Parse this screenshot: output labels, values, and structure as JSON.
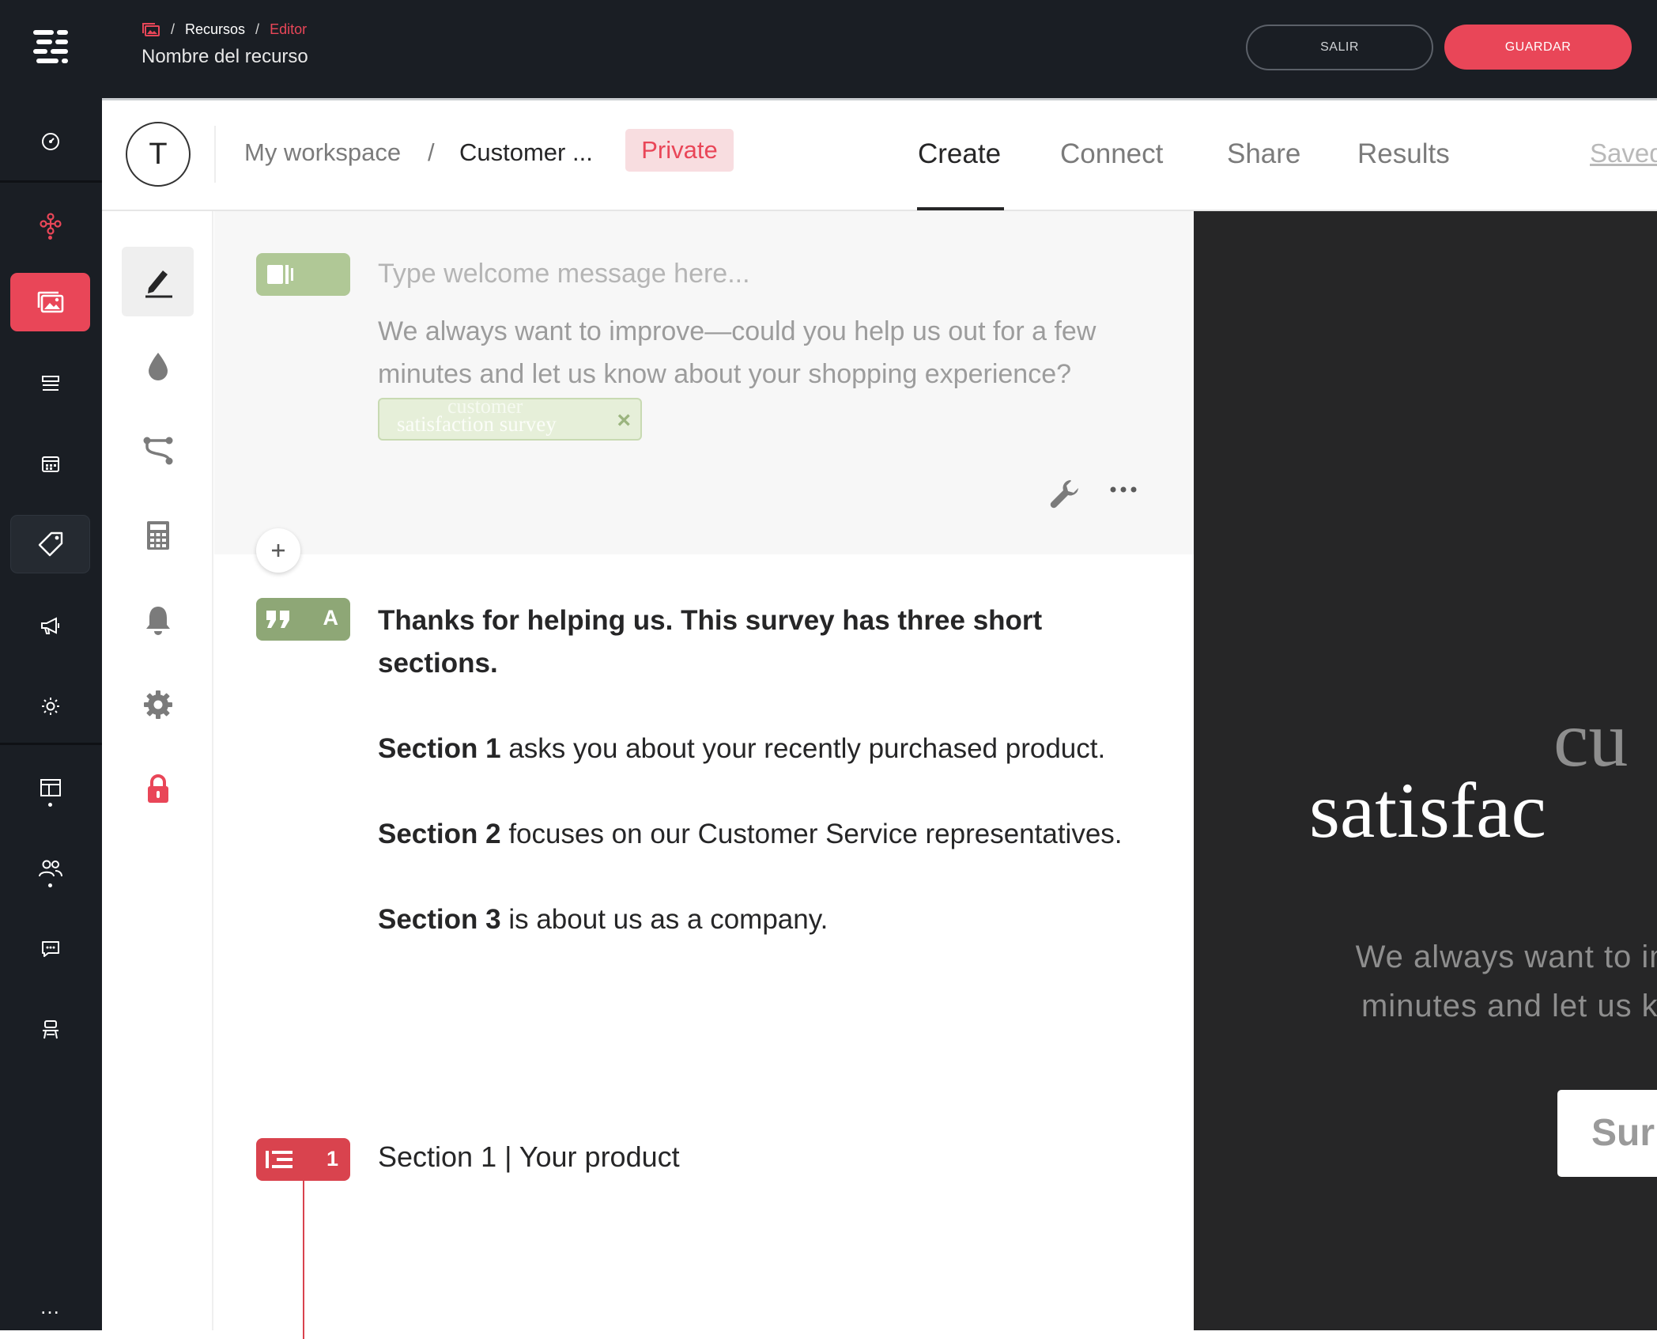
{
  "topbar": {
    "breadcrumb": [
      "Recursos",
      "Editor"
    ],
    "breadcrumb_sep": "/",
    "resource_name": "Nombre del recurso",
    "exit_label": "SALIR",
    "save_label": "GUARDAR"
  },
  "rail": {
    "items": [
      "menu-icon",
      "dashboard-icon",
      "integrations-icon",
      "media-icon",
      "list-icon",
      "calendar-icon",
      "tag-icon",
      "megaphone-icon",
      "brightness-icon",
      "layout-icon",
      "users-icon",
      "chat-icon",
      "seat-icon",
      "more-icon"
    ],
    "active_item": "media-icon",
    "more_label": "..."
  },
  "app_header": {
    "logo_letter": "T",
    "workspace": "My workspace",
    "crumb_sep": "/",
    "form_name": "Customer ...",
    "privacy_badge": "Private",
    "tabs": [
      "Create",
      "Connect",
      "Share",
      "Results"
    ],
    "active_tab": "Create",
    "saved_label": "Saved"
  },
  "tools": [
    "pen-icon",
    "droplet-icon",
    "logic-icon",
    "calculator-icon",
    "bell-icon",
    "gear-icon",
    "lock-icon"
  ],
  "editor": {
    "welcome": {
      "placeholder": "Type welcome message here...",
      "description": "We always want to improve—could you help us out for a few minutes and let us know about your shopping experience?",
      "chip_line1": "customer",
      "chip_line2": "satisfaction survey",
      "add_label": "+"
    },
    "statement": {
      "pill_letter": "A",
      "lead": "Thanks for helping us. This survey has three short sections.",
      "sections": [
        {
          "bold": "Section 1",
          "rest": " asks you about your recently purchased product."
        },
        {
          "bold": "Section 2",
          "rest": " focuses on our Customer Service representatives."
        },
        {
          "bold": "Section 3",
          "rest": " is about us as a company."
        }
      ]
    },
    "section_group": {
      "number": "1",
      "title": "Section 1 | Your product"
    }
  },
  "preview": {
    "title_line1": "cu",
    "title_line2": "satisfac",
    "desc_line1": "We always want to impro",
    "desc_line2": "minutes and let us know",
    "button_label": "Sur"
  },
  "colors": {
    "accent": "#e94658",
    "dark": "#1a1e24",
    "welcome_green": "#b0c896",
    "statement_green": "#8ea776",
    "section_red": "#d9434e",
    "preview_bg": "#262627"
  }
}
